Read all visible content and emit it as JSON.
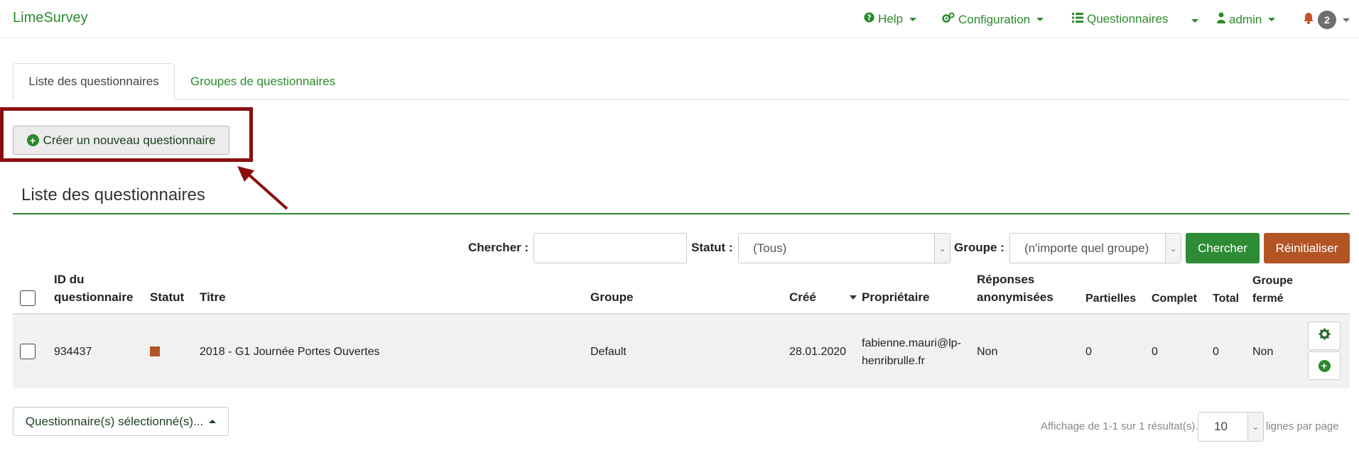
{
  "navbar": {
    "brand": "LimeSurvey",
    "help": "Help",
    "configuration": "Configuration",
    "questionnaires": "Questionnaires",
    "admin": "admin",
    "notifications_count": "2"
  },
  "tabs": {
    "active": "Liste des questionnaires",
    "groups": "Groupes de questionnaires"
  },
  "create_button": "Créer un nouveau questionnaire",
  "section_title": "Liste des questionnaires",
  "filters": {
    "search_label": "Chercher :",
    "search_value": "",
    "status_label": "Statut :",
    "status_value": "(Tous)",
    "group_label": "Groupe :",
    "group_value": "(n'importe quel groupe)",
    "search_button": "Chercher",
    "reset_button": "Réinitialiser"
  },
  "table": {
    "headers": {
      "id_line1": "ID du",
      "id_line2": "questionnaire",
      "status": "Statut",
      "title": "Titre",
      "group": "Groupe",
      "created": "Créé",
      "owner": "Propriétaire",
      "anon_line1": "Réponses",
      "anon_line2": "anonymisées",
      "partial": "Partielles",
      "complete": "Complet",
      "total": "Total",
      "closed_line1": "Groupe",
      "closed_line2": "fermé"
    },
    "rows": [
      {
        "id": "934437",
        "status_color": "#b35425",
        "title": "2018 - G1 Journée Portes Ouvertes",
        "group": "Default",
        "created": "28.01.2020",
        "owner_line1": "fabienne.mauri@lp-",
        "owner_line2": "henribrulle.fr",
        "anonymized": "Non",
        "partial": "0",
        "complete": "0",
        "total": "0",
        "group_closed": "Non"
      }
    ]
  },
  "footer": {
    "selected_button": "Questionnaire(s) sélectionné(s)...",
    "pager_info": "Affichage de 1-1 sur 1 résultat(s).",
    "page_size": "10",
    "page_size_suffix": "lignes par page"
  },
  "icons": [
    "question-circle-icon",
    "cogs-icon",
    "list-icon",
    "user-icon",
    "bell-icon",
    "plus-circle-icon",
    "gear-icon",
    "sort-desc-icon"
  ]
}
